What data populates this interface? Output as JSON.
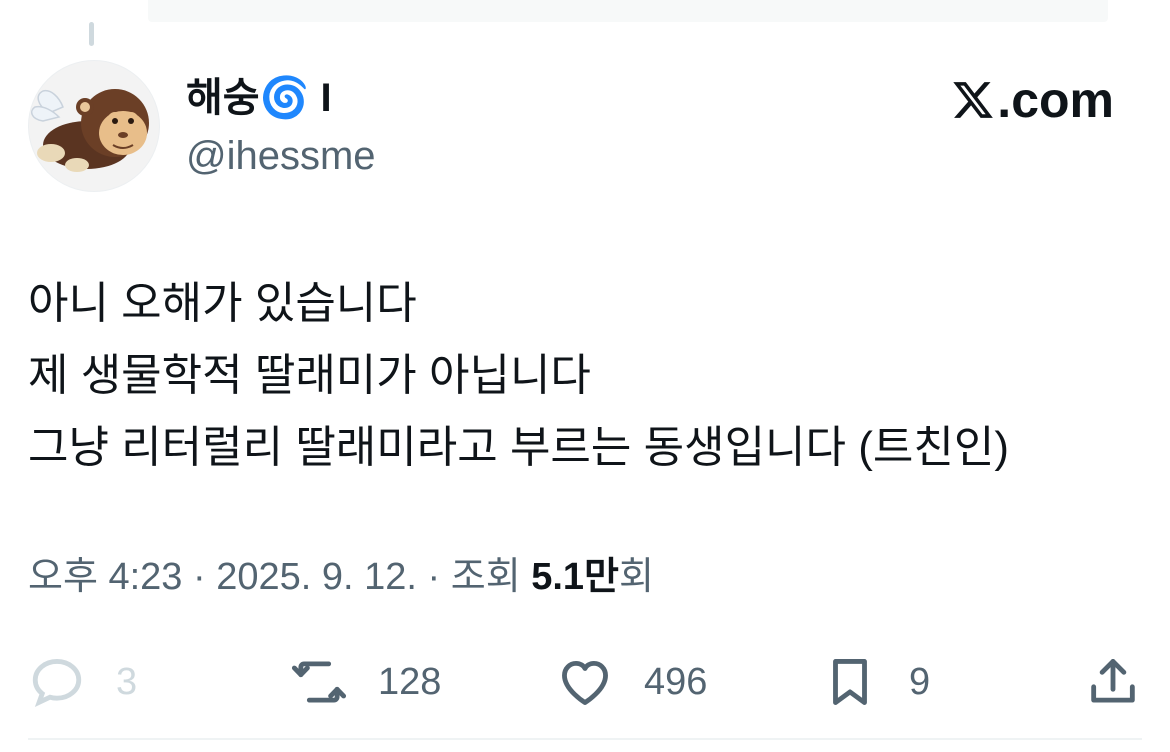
{
  "author": {
    "display_name": "해숭🌀 I",
    "handle": "@ihessme"
  },
  "brand": {
    "label": ".com",
    "logo_icon": "x-logo-icon"
  },
  "tweet": {
    "lines": [
      "아니 오해가 있습니다",
      "제 생물학적 딸래미가 아닙니다",
      "그냥 리터럴리 딸래미라고 부르는 동생입니다 (트친인)"
    ]
  },
  "meta": {
    "time": "오후 4:23",
    "sep1": " · ",
    "date": "2025. 9. 12.",
    "sep2": " · ",
    "views_prefix": "조회 ",
    "views_value": "5.1만",
    "views_suffix": "회"
  },
  "actions": {
    "reply": {
      "icon": "reply-icon",
      "count": "3"
    },
    "retweet": {
      "icon": "retweet-icon",
      "count": "128"
    },
    "like": {
      "icon": "heart-icon",
      "count": "496"
    },
    "bookmark": {
      "icon": "bookmark-icon",
      "count": "9"
    },
    "share": {
      "icon": "share-icon"
    }
  },
  "colors": {
    "text_primary": "#0f1419",
    "text_secondary": "#536471",
    "divider": "#eff3f4",
    "thread_line": "#cfd9de"
  }
}
